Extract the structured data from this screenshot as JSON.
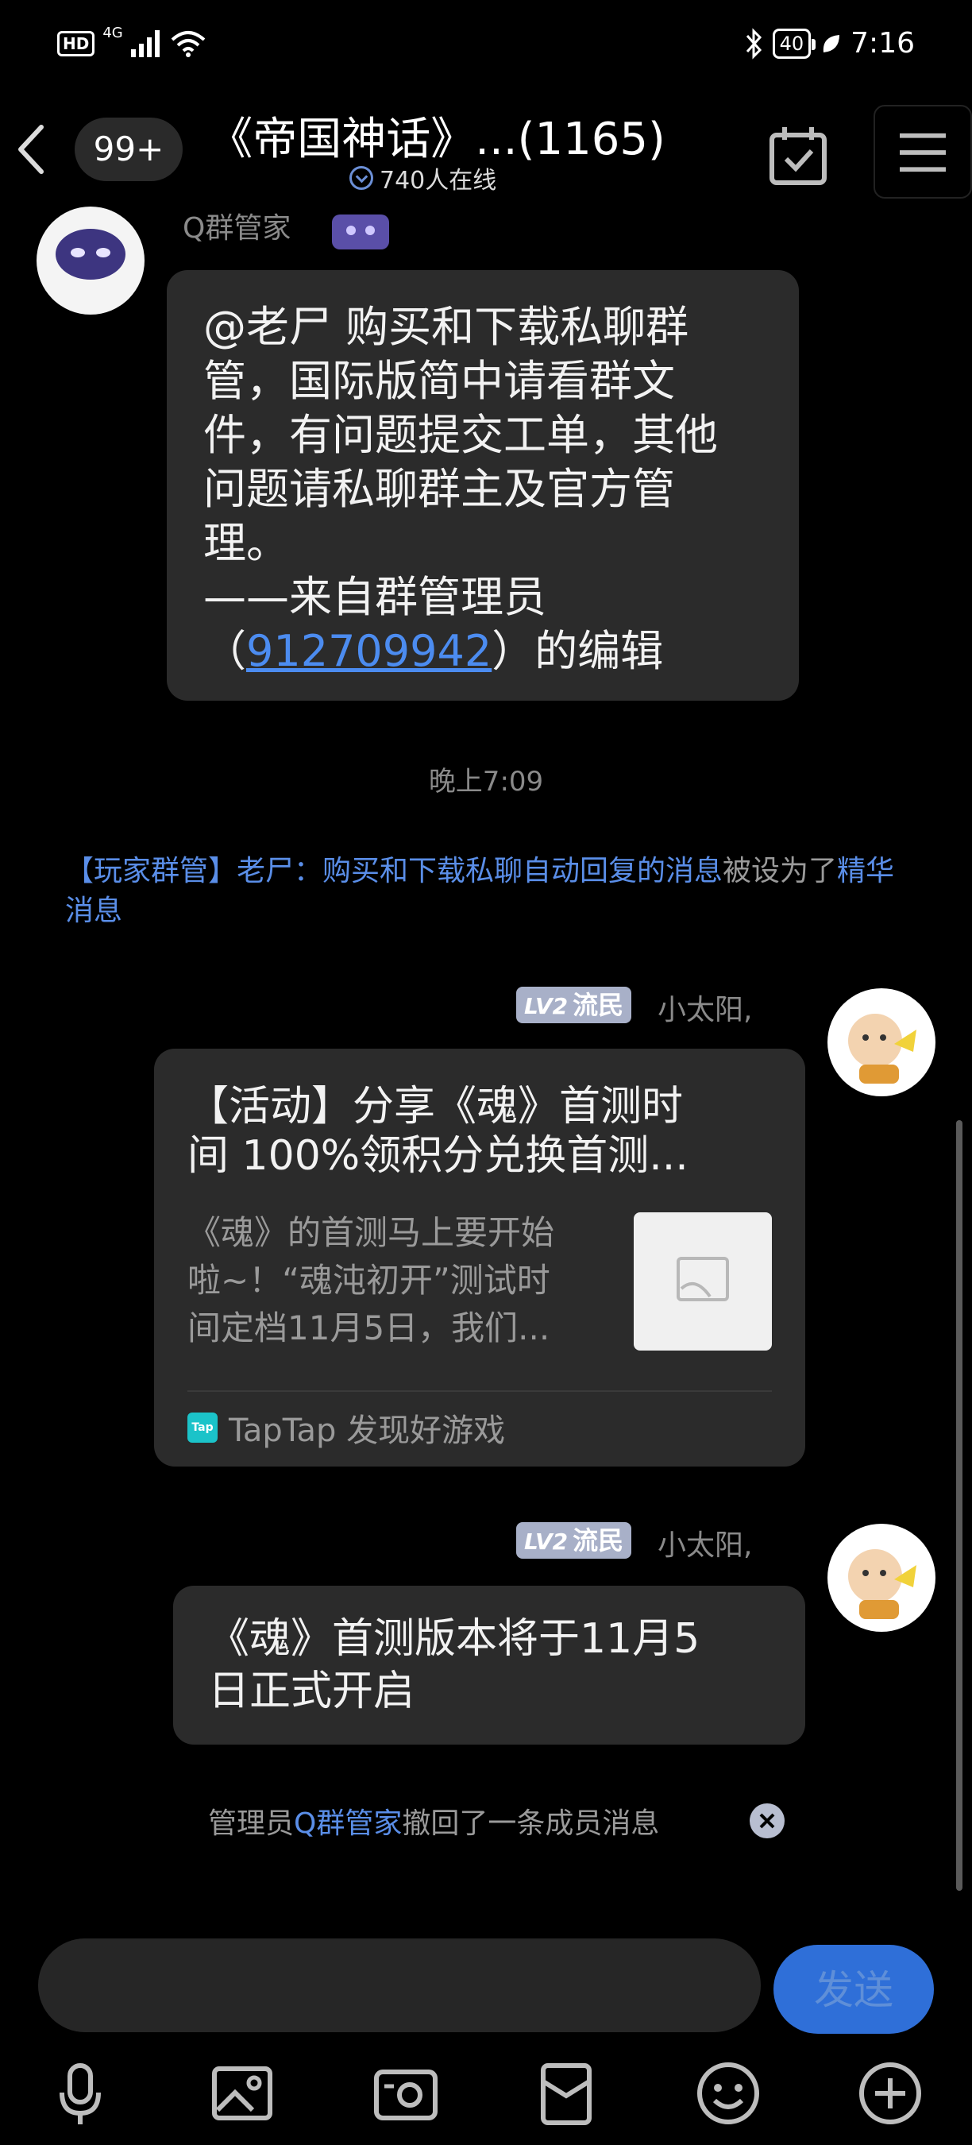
{
  "status_bar": {
    "hd": "HD",
    "network": "4G",
    "battery": "40",
    "time": "7:16"
  },
  "header": {
    "unread_count": "99+",
    "title": "《帝国神话》...(1165)",
    "online_text": "740人在线"
  },
  "messages": [
    {
      "sender": "Q群管家",
      "text_line1": "@老尸 购买和下载私聊群\n管，国际版简中请看群文\n件，有问题提交工单，其他\n问题请私聊群主及官方管\n理。\n——来自群管理员\n（",
      "link": "912709942",
      "text_line2": "）的编辑"
    },
    {
      "timestamp": "晚上7:09"
    },
    {
      "system_prefix": "【玩家群管】老尸：购买和下载私聊自动回复的消息",
      "system_middle": "被设为了",
      "system_suffix": "精华消息"
    },
    {
      "level": "LV2",
      "rank": "流民",
      "sender": "小太阳,",
      "card_title": "【活动】分享《魂》首测时\n间 100%领积分兑换首测...",
      "card_desc": "《魂》的首测马上要开始\n啦~！“魂沌初开”测试时\n间定档11月5日，我们...",
      "card_source": "TapTap 发现好游戏",
      "card_source_icon": "Tap"
    },
    {
      "level": "LV2",
      "rank": "流民",
      "sender": "小太阳,",
      "text": "《魂》首测版本将于11月5\n日正式开启"
    },
    {
      "recall_prefix": "管理员",
      "recall_admin": "Q群管家",
      "recall_suffix": "撤回了一条成员消息"
    }
  ],
  "input": {
    "placeholder": "",
    "send_label": "发送"
  },
  "colors": {
    "accent": "#4c8cf0",
    "bubble": "#2b2b2b",
    "background": "#000000",
    "level_badge": "#a8b0c8"
  }
}
